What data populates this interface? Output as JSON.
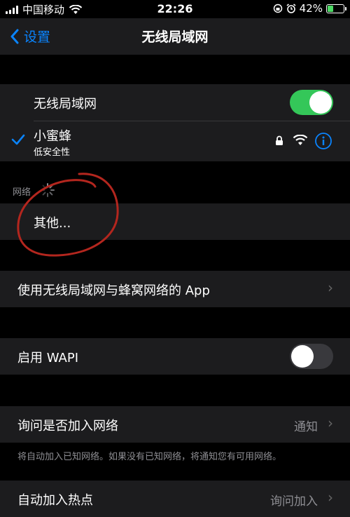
{
  "status_bar": {
    "carrier": "中国移动",
    "time": "22:26",
    "battery": "42%",
    "battery_level": 0.42
  },
  "nav": {
    "back_label": "设置",
    "title": "无线局域网"
  },
  "wifi": {
    "label": "无线局域网",
    "enabled": true
  },
  "connected": {
    "name": "小蜜蜂",
    "subtitle": "低安全性"
  },
  "networks": {
    "header": "网络",
    "other_label": "其他..."
  },
  "apps_row": {
    "label": "使用无线局域网与蜂窝网络的 App"
  },
  "wapi": {
    "label": "启用 WAPI",
    "enabled": false
  },
  "ask_join": {
    "label": "询问是否加入网络",
    "value": "通知",
    "note": "将自动加入已知网络。如果没有已知网络，将通知您有可用网络。"
  },
  "hotspot": {
    "label": "自动加入热点",
    "value": "询问加入"
  },
  "icons": {
    "signal": "signal-bars-icon",
    "wifi": "wifi-icon",
    "lock": "lock-icon",
    "info": "info-icon",
    "checkmark": "checkmark-icon",
    "spinner": "spinner-icon",
    "chevron": "chevron-right-icon"
  },
  "colors": {
    "accent": "#0a84ff",
    "toggle_on": "#34c759",
    "annotation": "#b3261e"
  }
}
